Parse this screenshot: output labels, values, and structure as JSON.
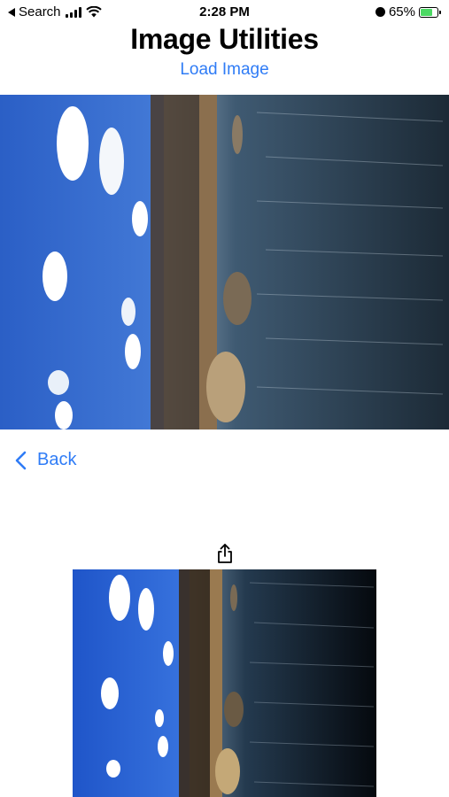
{
  "status_bar": {
    "back_app": "Search",
    "time": "2:28 PM",
    "battery": "65%"
  },
  "header": {
    "title": "Image Utilities",
    "load_link": "Load Image"
  },
  "navigation": {
    "back_label": "Back"
  },
  "icons": {
    "share": "share-icon",
    "back": "chevron-left-icon"
  },
  "colors": {
    "accent": "#2f7cf6"
  }
}
